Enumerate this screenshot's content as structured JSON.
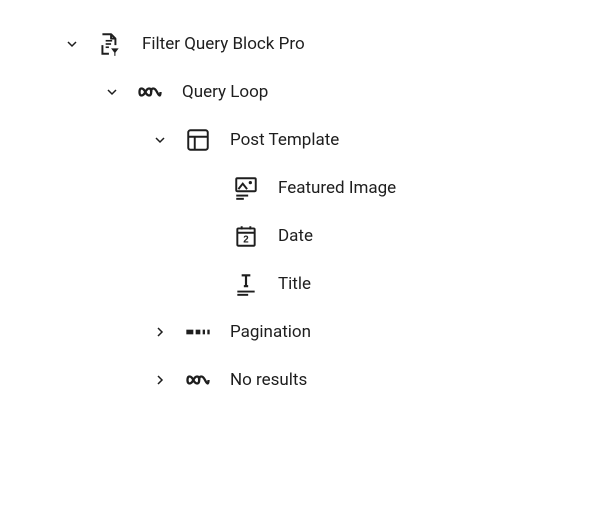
{
  "tree": {
    "filter_query_block_pro": {
      "label": "Filter Query Block Pro",
      "expanded": true
    },
    "query_loop": {
      "label": "Query Loop",
      "expanded": true
    },
    "post_template": {
      "label": "Post Template",
      "expanded": true
    },
    "featured_image": {
      "label": "Featured Image"
    },
    "date": {
      "label": "Date"
    },
    "title": {
      "label": "Title"
    },
    "pagination": {
      "label": "Pagination",
      "expanded": false
    },
    "no_results": {
      "label": "No results",
      "expanded": false
    }
  }
}
